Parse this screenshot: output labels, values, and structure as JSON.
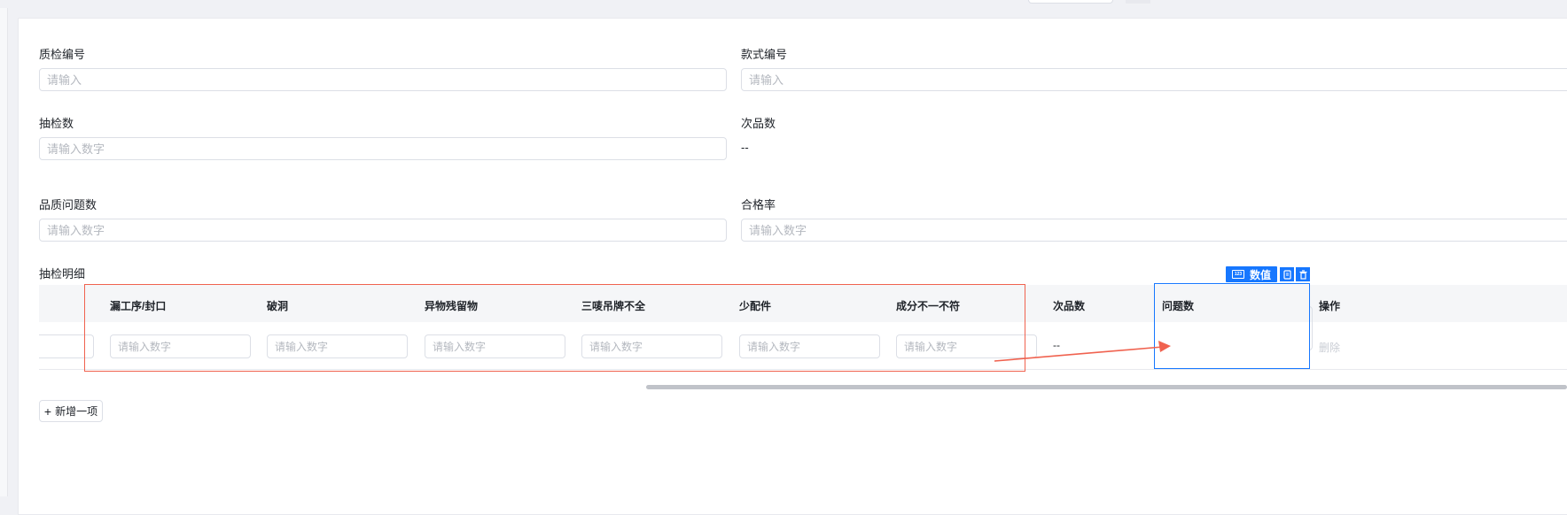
{
  "form": {
    "qc_no": {
      "label": "质检编号",
      "placeholder": "请输入"
    },
    "style_no": {
      "label": "款式编号",
      "placeholder": "请输入"
    },
    "sample_count": {
      "label": "抽检数",
      "placeholder": "请输入数字"
    },
    "defect_count": {
      "label": "次品数",
      "value": "--"
    },
    "quality_issue_count": {
      "label": "品质问题数",
      "placeholder": "请输入数字"
    },
    "pass_rate": {
      "label": "合格率",
      "placeholder": "请输入数字"
    }
  },
  "detail": {
    "title": "抽检明细",
    "columns": [
      "漏工序/封口",
      "破洞",
      "异物残留物",
      "三唛吊牌不全",
      "少配件",
      "成分不一不符",
      "次品数",
      "问题数",
      "操作"
    ],
    "row": {
      "placeholder": "请输入数字",
      "defect_value": "--",
      "issue_value": "-",
      "action_label": "删除"
    },
    "add_label": "新增一项"
  },
  "widget_badge": {
    "label": "数值"
  },
  "colors": {
    "primary": "#1677ff",
    "highlight_red": "#f0624f"
  }
}
